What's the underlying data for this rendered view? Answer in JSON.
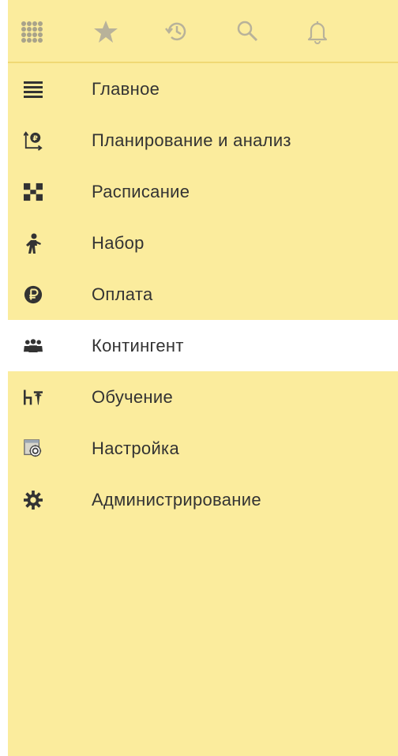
{
  "topbar": {
    "icons": [
      {
        "name": "apps-grid-icon"
      },
      {
        "name": "favorites-star-icon"
      },
      {
        "name": "history-icon"
      },
      {
        "name": "search-icon"
      },
      {
        "name": "notifications-bell-icon"
      }
    ]
  },
  "menu": {
    "items": [
      {
        "label": "Главное",
        "icon": "list-lines-icon",
        "active": false
      },
      {
        "label": "Планирование и анализ",
        "icon": "planning-chart-icon",
        "active": false
      },
      {
        "label": "Расписание",
        "icon": "schedule-icon",
        "active": false
      },
      {
        "label": "Набор",
        "icon": "recruitment-person-icon",
        "active": false
      },
      {
        "label": "Оплата",
        "icon": "ruble-coin-icon",
        "active": false
      },
      {
        "label": "Контингент",
        "icon": "people-group-icon",
        "active": true
      },
      {
        "label": "Обучение",
        "icon": "education-desk-icon",
        "active": false
      },
      {
        "label": "Настройка",
        "icon": "settings-panel-icon",
        "active": false
      },
      {
        "label": "Администрирование",
        "icon": "gear-icon",
        "active": false
      }
    ]
  },
  "colors": {
    "panel_background": "#fbec9d",
    "active_background": "#ffffff",
    "icon_dark": "#333333",
    "icon_muted": "#b8b29a"
  }
}
